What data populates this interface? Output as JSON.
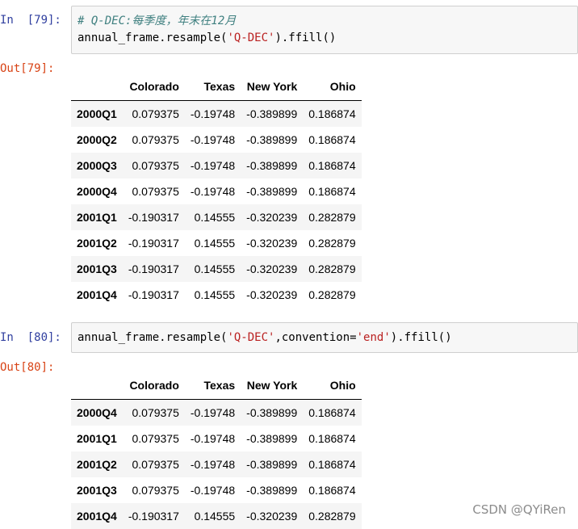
{
  "cells": [
    {
      "in_prompt": "In  [79]:",
      "code_comment": "# Q-DEC:每季度，年末在12月",
      "code_line2_a": "annual_frame.resample(",
      "code_line2_str": "'Q-DEC'",
      "code_line2_b": ").ffill()",
      "out_prompt": "Out[79]:",
      "table": {
        "columns": [
          "",
          "Colorado",
          "Texas",
          "New York",
          "Ohio"
        ],
        "rows": [
          [
            "2000Q1",
            "0.079375",
            "-0.19748",
            "-0.389899",
            "0.186874"
          ],
          [
            "2000Q2",
            "0.079375",
            "-0.19748",
            "-0.389899",
            "0.186874"
          ],
          [
            "2000Q3",
            "0.079375",
            "-0.19748",
            "-0.389899",
            "0.186874"
          ],
          [
            "2000Q4",
            "0.079375",
            "-0.19748",
            "-0.389899",
            "0.186874"
          ],
          [
            "2001Q1",
            "-0.190317",
            "0.14555",
            "-0.320239",
            "0.282879"
          ],
          [
            "2001Q2",
            "-0.190317",
            "0.14555",
            "-0.320239",
            "0.282879"
          ],
          [
            "2001Q3",
            "-0.190317",
            "0.14555",
            "-0.320239",
            "0.282879"
          ],
          [
            "2001Q4",
            "-0.190317",
            "0.14555",
            "-0.320239",
            "0.282879"
          ]
        ]
      }
    },
    {
      "in_prompt": "In  [80]:",
      "code_a": "annual_frame.resample(",
      "code_str1": "'Q-DEC'",
      "code_b": ",convention=",
      "code_str2": "'end'",
      "code_c": ").ffill()",
      "out_prompt": "Out[80]:",
      "table": {
        "columns": [
          "",
          "Colorado",
          "Texas",
          "New York",
          "Ohio"
        ],
        "rows": [
          [
            "2000Q4",
            "0.079375",
            "-0.19748",
            "-0.389899",
            "0.186874"
          ],
          [
            "2001Q1",
            "0.079375",
            "-0.19748",
            "-0.389899",
            "0.186874"
          ],
          [
            "2001Q2",
            "0.079375",
            "-0.19748",
            "-0.389899",
            "0.186874"
          ],
          [
            "2001Q3",
            "0.079375",
            "-0.19748",
            "-0.389899",
            "0.186874"
          ],
          [
            "2001Q4",
            "-0.190317",
            "0.14555",
            "-0.320239",
            "0.282879"
          ]
        ]
      }
    }
  ],
  "watermark": "CSDN @QYiRen"
}
